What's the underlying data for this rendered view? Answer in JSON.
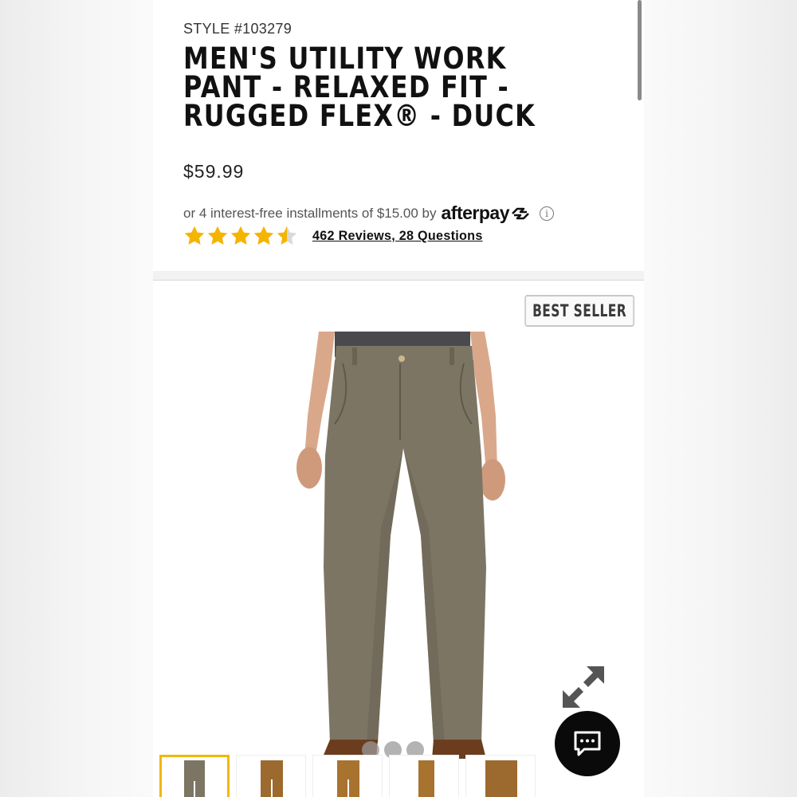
{
  "product": {
    "style_number": "STYLE #103279",
    "title_line1": "MEN'S UTILITY WORK",
    "title_line2": "PANT - RELAXED FIT -",
    "title_line3": "RUGGED FLEX® - DUCK",
    "price": "$59.99"
  },
  "afterpay": {
    "text": "or 4 interest-free installments of $15.00 by",
    "brand": "afterpay",
    "info_icon": "info-icon"
  },
  "rating": {
    "stars": 4.5,
    "max_stars": 5,
    "star_color": "#f5b400",
    "reviews_link": "462 Reviews, 28 Questions"
  },
  "gallery": {
    "badge": "BEST SELLER",
    "image_alt": "Men's utility work pant in tan/olive duck",
    "pant_color": "#7d7564",
    "shirt_color": "#4a4a4e",
    "active_thumbnail_color": "#f2b705",
    "thumbnails": [
      {
        "color": "#7d7564",
        "selected": true
      },
      {
        "color": "#9c6a2e",
        "selected": false
      },
      {
        "color": "#a8722f",
        "selected": false
      },
      {
        "color": "#a8722f",
        "selected": false
      },
      {
        "color": "#9c6a2e",
        "selected": false
      }
    ],
    "carousel_dots": 3
  },
  "icons": {
    "expand": "expand-icon",
    "chat": "chat-icon"
  }
}
